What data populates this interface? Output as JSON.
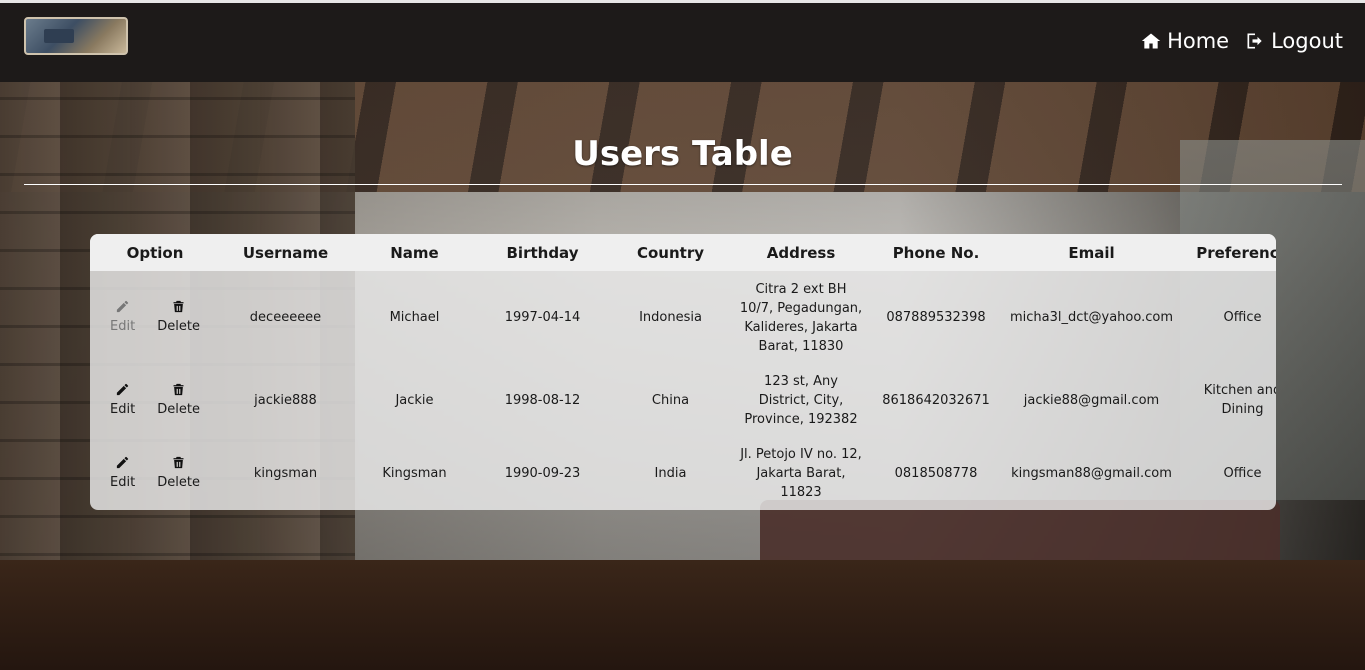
{
  "nav": {
    "home_label": "Home",
    "logout_label": "Logout"
  },
  "page": {
    "title": "Users Table"
  },
  "table": {
    "headers": [
      "Option",
      "Username",
      "Name",
      "Birthday",
      "Country",
      "Address",
      "Phone No.",
      "Email",
      "Preference"
    ],
    "edit_label": "Edit",
    "delete_label": "Delete",
    "rows": [
      {
        "username": "deceeeeee",
        "name": "Michael",
        "birthday": "1997-04-14",
        "country": "Indonesia",
        "address": "Citra 2 ext BH 10/7, Pegadungan, Kalideres, Jakarta Barat, 11830",
        "phone": "087889532398",
        "email": "micha3l_dct@yahoo.com",
        "preference": "Office"
      },
      {
        "username": "jackie888",
        "name": "Jackie",
        "birthday": "1998-08-12",
        "country": "China",
        "address": "123 st, Any District, City, Province, 192382",
        "phone": "8618642032671",
        "email": "jackie88@gmail.com",
        "preference": "Kitchen and Dining"
      },
      {
        "username": "kingsman",
        "name": "Kingsman",
        "birthday": "1990-09-23",
        "country": "India",
        "address": "Jl. Petojo IV no. 12, Jakarta Barat, 11823",
        "phone": "0818508778",
        "email": "kingsman88@gmail.com",
        "preference": "Office"
      }
    ]
  },
  "icons": {
    "home": "home-icon",
    "logout": "logout-icon",
    "edit": "pencil-icon",
    "delete": "trash-icon"
  }
}
